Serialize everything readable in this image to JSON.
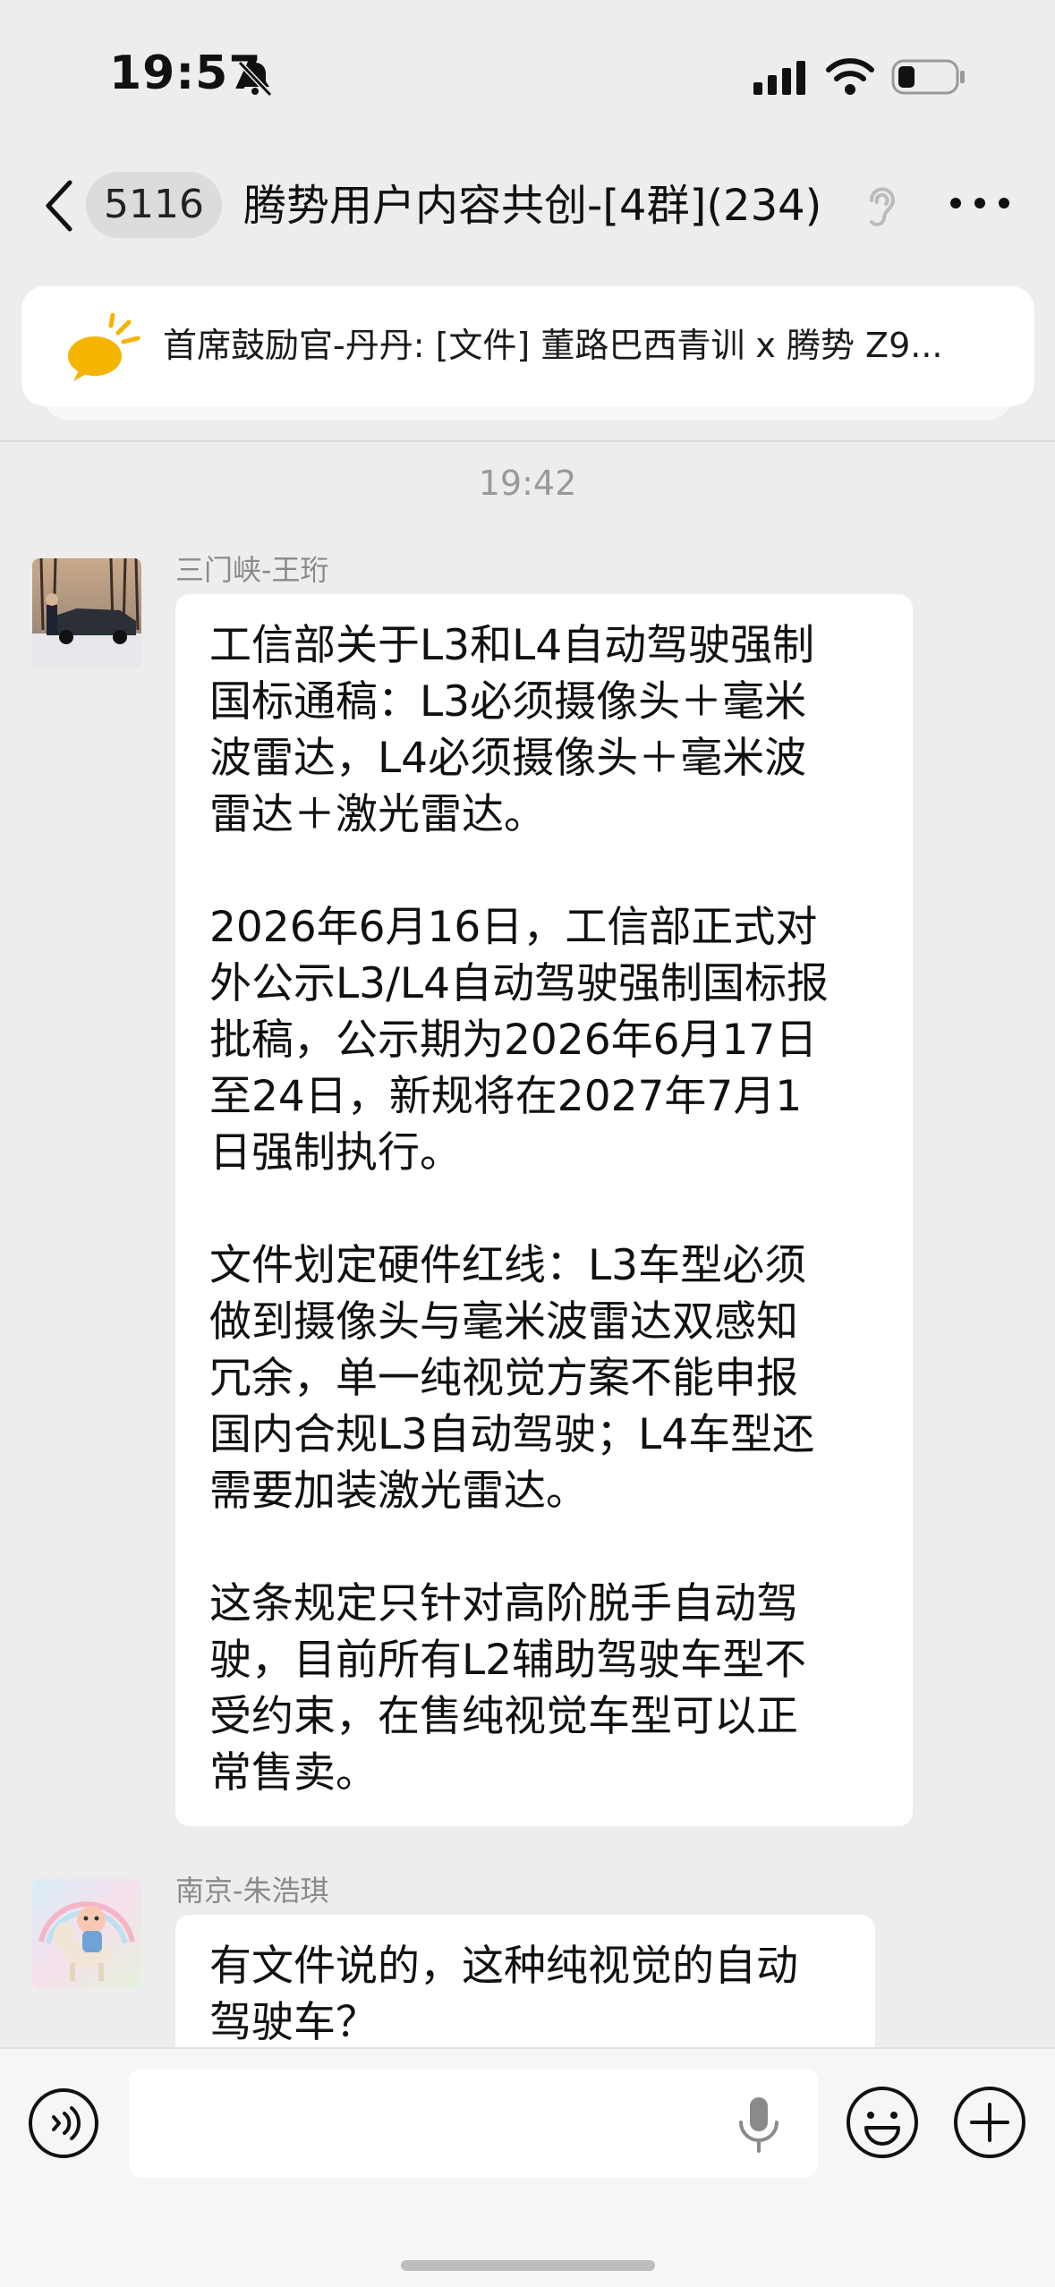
{
  "status_bar": {
    "time": "19:57"
  },
  "header": {
    "unread_count": "5116",
    "title": "腾势用户内容共创-[4群](234)"
  },
  "announcement": {
    "text": "首席鼓励官-丹丹: [文件] 董路巴西青训 x 腾势 Z9..."
  },
  "timestamp": "19:42",
  "messages": [
    {
      "sender": "三门峡-王珩",
      "paragraphs": [
        "工信部关于L3和L4自动驾驶强制\n国标通稿：L3必须摄像头＋毫米\n波雷达，L4必须摄像头＋毫米波\n雷达＋激光雷达。",
        "2026年6月16日，工信部正式对\n外公示L3/L4自动驾驶强制国标报\n批稿，公示期为2026年6月17日\n至24日，新规将在2027年7月1\n日强制执行。",
        "文件划定硬件红线：L3车型必须\n做到摄像头与毫米波雷达双感知\n冗余，单一纯视觉方案不能申报\n国内合规L3自动驾驶；L4车型还\n需要加装激光雷达。",
        "这条规定只针对高阶脱手自动驾\n驶，目前所有L2辅助驾驶车型不\n受约束，在售纯视觉车型可以正\n常售卖。"
      ]
    },
    {
      "sender": "南京-朱浩琪",
      "paragraphs": [
        "有文件说的，这种纯视觉的自动\n驾驶车？"
      ]
    }
  ],
  "input": {
    "value": "",
    "placeholder": ""
  },
  "icons": {
    "back": "chevron-left-icon",
    "more": "more-dots-icon",
    "ear": "ear-icon",
    "announcement": "horn-icon",
    "voice": "voice-icon",
    "mic": "mic-icon",
    "emoji": "emoji-icon",
    "plus": "plus-icon"
  },
  "colors": {
    "background": "#ededed",
    "bubble": "#ffffff",
    "announcement_icon": "#f4b400"
  }
}
